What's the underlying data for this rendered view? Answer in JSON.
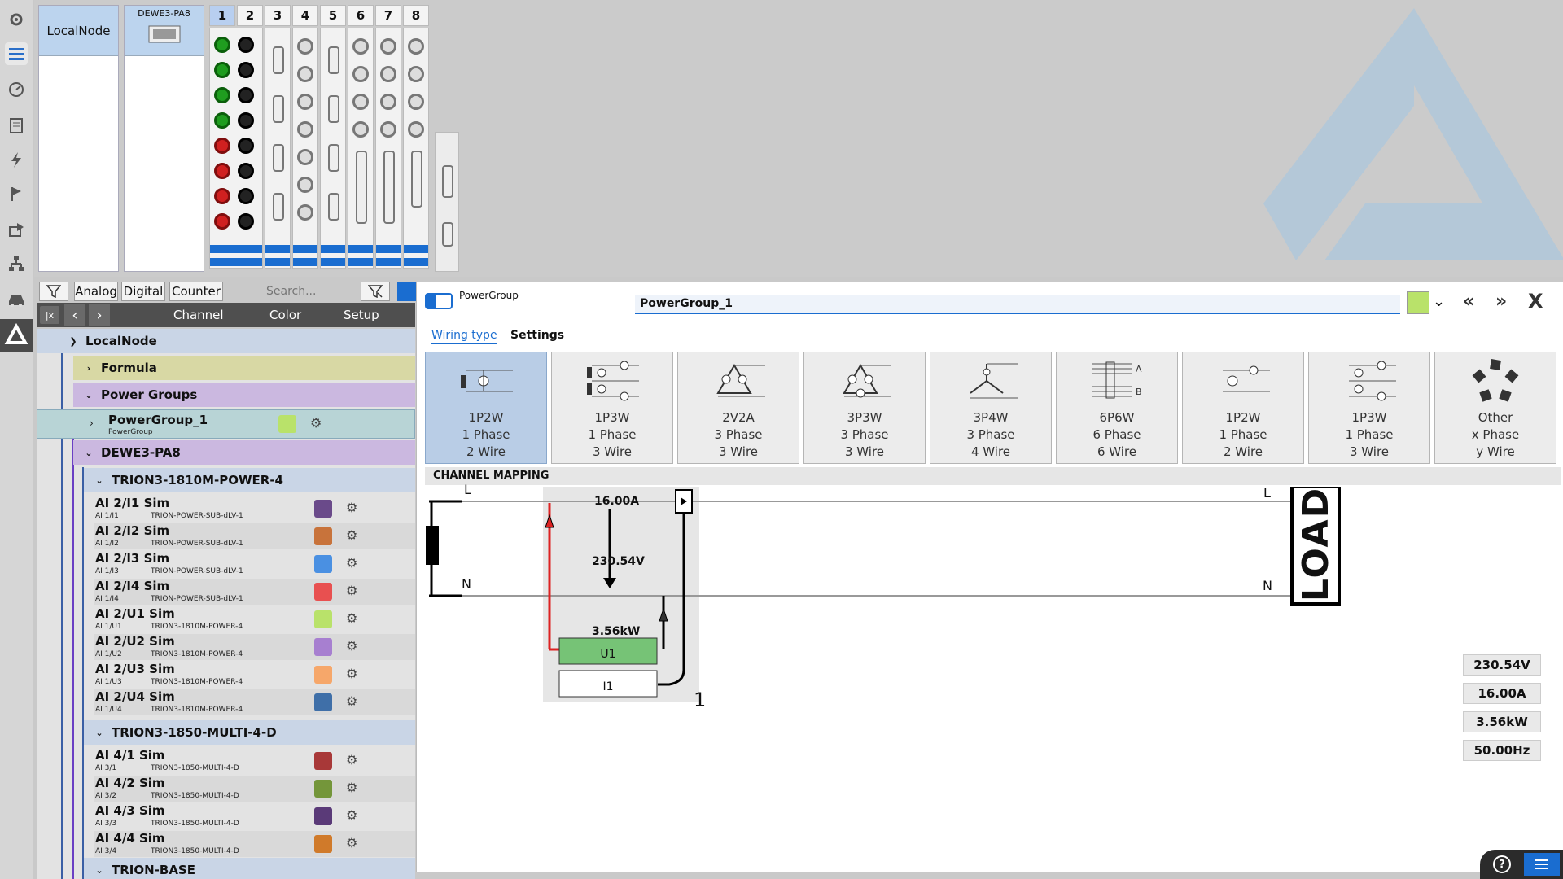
{
  "system": {
    "local_node_label": "LocalNode",
    "device_label": "DEWE3-PA8",
    "slot_numbers": [
      "1",
      "2",
      "3",
      "4",
      "5",
      "6",
      "7",
      "8"
    ]
  },
  "filter_bar": {
    "analog": "Analog",
    "digital": "Digital",
    "counter": "Counter",
    "search_placeholder": "Search..."
  },
  "channel_header": {
    "channel": "Channel",
    "color": "Color",
    "setup": "Setup"
  },
  "tree": {
    "local_node": "LocalNode",
    "formula": "Formula",
    "power_groups": "Power Groups",
    "power_group_1": {
      "name": "PowerGroup_1",
      "sub": "PowerGroup",
      "color": "#b9e26a"
    },
    "dewe": "DEWE3-PA8",
    "module1": "TRION3-1810M-POWER-4",
    "module2": "TRION3-1850-MULTI-4-D",
    "base": "TRION-BASE",
    "module1_channels": [
      {
        "name": "AI 2/I1 Sim",
        "sub": "AI 1/I1",
        "type": "TRION-POWER-SUB-dLV-1",
        "color": "#6a4a8a"
      },
      {
        "name": "AI 2/I2 Sim",
        "sub": "AI 1/I2",
        "type": "TRION-POWER-SUB-dLV-1",
        "color": "#c8733b"
      },
      {
        "name": "AI 2/I3 Sim",
        "sub": "AI 1/I3",
        "type": "TRION-POWER-SUB-dLV-1",
        "color": "#4a90e2"
      },
      {
        "name": "AI 2/I4 Sim",
        "sub": "AI 1/I4",
        "type": "TRION-POWER-SUB-dLV-1",
        "color": "#e85050"
      },
      {
        "name": "AI 2/U1 Sim",
        "sub": "AI 1/U1",
        "type": "TRION3-1810M-POWER-4",
        "color": "#b9e26a"
      },
      {
        "name": "AI 2/U2 Sim",
        "sub": "AI 1/U2",
        "type": "TRION3-1810M-POWER-4",
        "color": "#a77fd0"
      },
      {
        "name": "AI 2/U3 Sim",
        "sub": "AI 1/U3",
        "type": "TRION3-1810M-POWER-4",
        "color": "#f6a76a"
      },
      {
        "name": "AI 2/U4 Sim",
        "sub": "AI 1/U4",
        "type": "TRION3-1810M-POWER-4",
        "color": "#3f6fa8"
      }
    ],
    "module2_channels": [
      {
        "name": "AI 4/1 Sim",
        "sub": "AI 3/1",
        "type": "TRION3-1850-MULTI-4-D",
        "color": "#a83838"
      },
      {
        "name": "AI 4/2 Sim",
        "sub": "AI 3/2",
        "type": "TRION3-1850-MULTI-4-D",
        "color": "#74963a"
      },
      {
        "name": "AI 4/3 Sim",
        "sub": "AI 3/3",
        "type": "TRION3-1850-MULTI-4-D",
        "color": "#5a3a78"
      },
      {
        "name": "AI 4/4 Sim",
        "sub": "AI 3/4",
        "type": "TRION3-1850-MULTI-4-D",
        "color": "#d07a2a"
      }
    ]
  },
  "panel": {
    "type_label": "PowerGroup",
    "name_value": "PowerGroup_1",
    "color": "#b9e26a",
    "close": "X",
    "tabs": [
      "Wiring type",
      "Settings"
    ],
    "wiring": [
      {
        "code": "1P2W",
        "phase": "1 Phase",
        "wire": "2 Wire"
      },
      {
        "code": "1P3W",
        "phase": "1 Phase",
        "wire": "3 Wire"
      },
      {
        "code": "2V2A",
        "phase": "3 Phase",
        "wire": "3 Wire"
      },
      {
        "code": "3P3W",
        "phase": "3 Phase",
        "wire": "3 Wire"
      },
      {
        "code": "3P4W",
        "phase": "3 Phase",
        "wire": "4 Wire"
      },
      {
        "code": "6P6W",
        "phase": "6 Phase",
        "wire": "6 Wire"
      },
      {
        "code": "1P2W",
        "phase": "1 Phase",
        "wire": "2 Wire"
      },
      {
        "code": "1P3W",
        "phase": "1 Phase",
        "wire": "3 Wire"
      },
      {
        "code": "Other",
        "phase": "x Phase",
        "wire": "y Wire"
      }
    ],
    "mapping_title": "CHANNEL MAPPING",
    "diagram": {
      "L": "L",
      "N": "N",
      "load": "LOAD",
      "current": "16.00A",
      "voltage": "230.54V",
      "power": "3.56kW",
      "u1": "U1",
      "i1": "I1",
      "num": "1"
    },
    "measurements": [
      "230.54V",
      "16.00A",
      "3.56kW",
      "50.00Hz"
    ],
    "help": "?"
  }
}
